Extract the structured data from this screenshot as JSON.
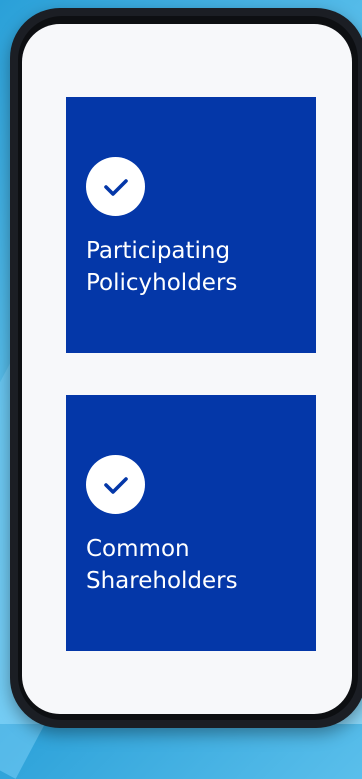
{
  "options": [
    {
      "label": "Participating\nPolicyholders",
      "icon": "check-icon",
      "selected": true
    },
    {
      "label": "Common\nShareholders",
      "icon": "check-icon",
      "selected": true
    }
  ],
  "colors": {
    "card_background": "#0437a8",
    "check_stroke": "#0437a8",
    "screen_background": "#f7f8fa",
    "background_blue": "#2aa0d8"
  }
}
